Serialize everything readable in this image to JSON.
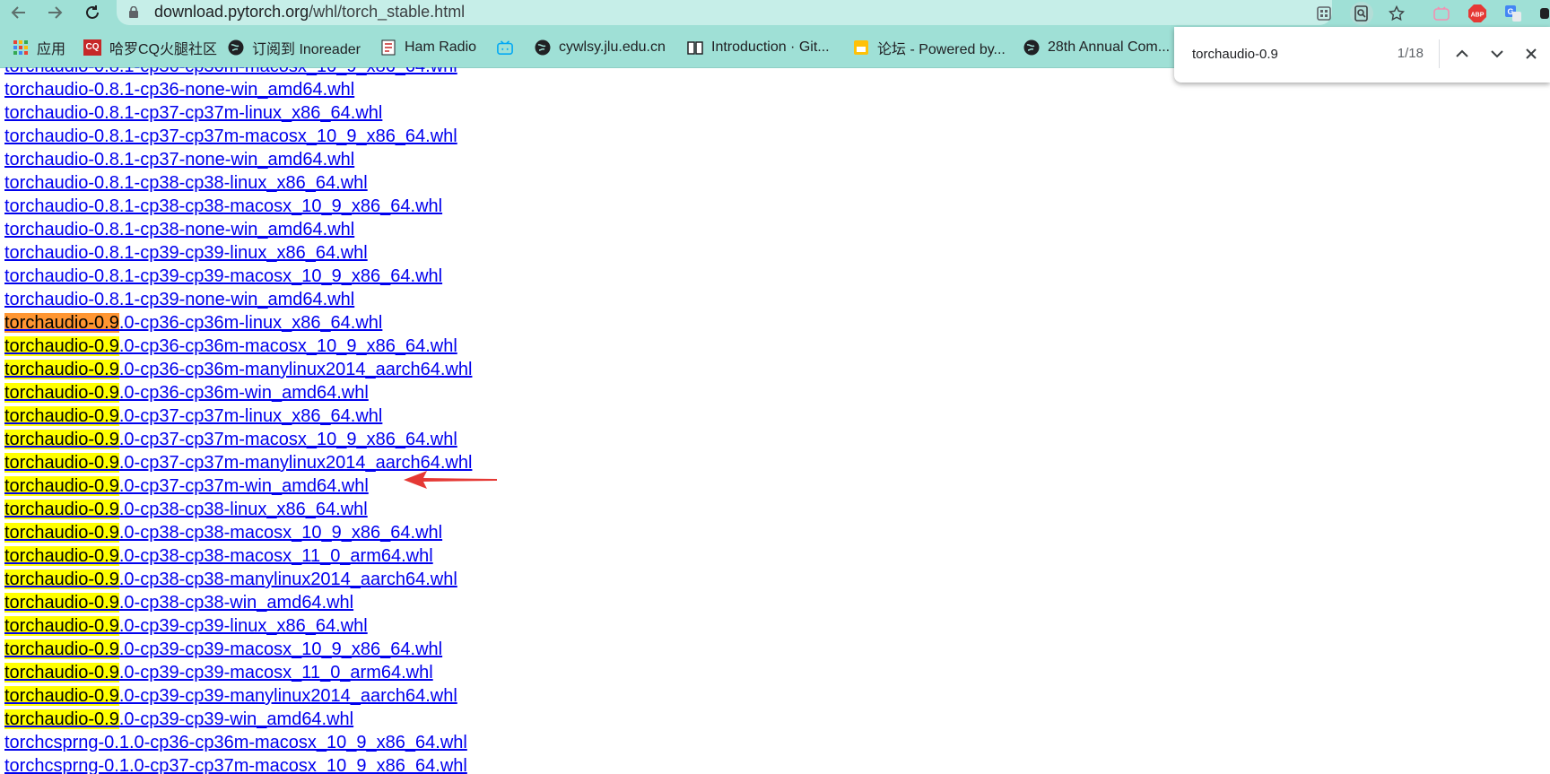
{
  "browser": {
    "url_host": "download.pytorch.org",
    "url_path": "/whl/torch_stable.html"
  },
  "bookmarks": [
    {
      "label": "应用",
      "icon": "apps-grid-icon"
    },
    {
      "label": "哈罗CQ火腿社区",
      "icon": "cq-icon"
    },
    {
      "label": "订阅到 Inoreader",
      "icon": "globe-icon"
    },
    {
      "label": "Ham Radio",
      "icon": "ham-radio-icon"
    },
    {
      "label": "",
      "icon": "bilibili-icon"
    },
    {
      "label": "cywlsy.jlu.edu.cn",
      "icon": "globe-icon"
    },
    {
      "label": "Introduction · Git...",
      "icon": "book-icon"
    },
    {
      "label": "论坛 - Powered by...",
      "icon": "forum-icon"
    },
    {
      "label": "28th Annual Com...",
      "icon": "globe-icon"
    }
  ],
  "find": {
    "query": "torchaudio-0.9",
    "count": "1/18"
  },
  "files": {
    "top_partial": "torchaudio-0.8.1-cp36-cp36m-macosx_10_9_x86_64.whl",
    "plain_before": [
      "torchaudio-0.8.1-cp36-none-win_amd64.whl",
      "torchaudio-0.8.1-cp37-cp37m-linux_x86_64.whl",
      "torchaudio-0.8.1-cp37-cp37m-macosx_10_9_x86_64.whl",
      "torchaudio-0.8.1-cp37-none-win_amd64.whl",
      "torchaudio-0.8.1-cp38-cp38-linux_x86_64.whl",
      "torchaudio-0.8.1-cp38-cp38-macosx_10_9_x86_64.whl",
      "torchaudio-0.8.1-cp38-none-win_amd64.whl",
      "torchaudio-0.8.1-cp39-cp39-linux_x86_64.whl",
      "torchaudio-0.8.1-cp39-cp39-macosx_10_9_x86_64.whl",
      "torchaudio-0.8.1-cp39-none-win_amd64.whl"
    ],
    "highlight_prefix": "torchaudio-0.9",
    "matched_suffixes": [
      ".0-cp36-cp36m-linux_x86_64.whl",
      ".0-cp36-cp36m-macosx_10_9_x86_64.whl",
      ".0-cp36-cp36m-manylinux2014_aarch64.whl",
      ".0-cp36-cp36m-win_amd64.whl",
      ".0-cp37-cp37m-linux_x86_64.whl",
      ".0-cp37-cp37m-macosx_10_9_x86_64.whl",
      ".0-cp37-cp37m-manylinux2014_aarch64.whl",
      ".0-cp37-cp37m-win_amd64.whl",
      ".0-cp38-cp38-linux_x86_64.whl",
      ".0-cp38-cp38-macosx_10_9_x86_64.whl",
      ".0-cp38-cp38-macosx_11_0_arm64.whl",
      ".0-cp38-cp38-manylinux2014_aarch64.whl",
      ".0-cp38-cp38-win_amd64.whl",
      ".0-cp39-cp39-linux_x86_64.whl",
      ".0-cp39-cp39-macosx_10_9_x86_64.whl",
      ".0-cp39-cp39-macosx_11_0_arm64.whl",
      ".0-cp39-cp39-manylinux2014_aarch64.whl",
      ".0-cp39-cp39-win_amd64.whl"
    ],
    "current_match_index": 0,
    "pointed_row_index": 7,
    "plain_after": [
      "torchcsprng-0.1.0-cp36-cp36m-macosx_10_9_x86_64.whl",
      "torchcsprng-0.1.0-cp37-cp37m-macosx_10_9_x86_64.whl"
    ]
  },
  "colors": {
    "match_highlight": "#ffff00",
    "current_match_highlight": "#ff9632",
    "link": "#0000ee",
    "annotation_arrow": "#e53935",
    "chrome_theme": "#9fe0d6"
  }
}
